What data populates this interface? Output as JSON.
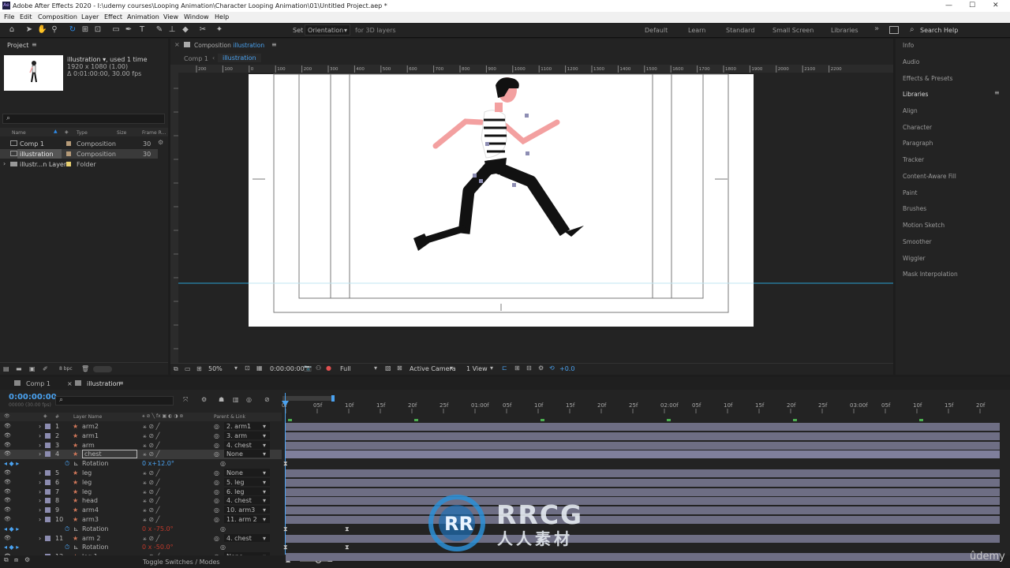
{
  "window": {
    "title": "Adobe After Effects 2020 - I:\\udemy courses\\Looping Animation\\Character Looping Animation\\01\\Untitled Project.aep *",
    "app_icon": "Ae",
    "minimize": "—",
    "maximize": "☐",
    "close": "✕"
  },
  "menu": [
    "File",
    "Edit",
    "Composition",
    "Layer",
    "Effect",
    "Animation",
    "View",
    "Window",
    "Help"
  ],
  "toolbar": {
    "set_label": "Set",
    "orientation": "Orientation",
    "for3d": "for 3D layers",
    "workspaces": [
      "Default",
      "Learn",
      "Standard",
      "Small Screen",
      "Libraries"
    ],
    "more": "»",
    "search_placeholder": "Search Help"
  },
  "project": {
    "title": "Project",
    "menu_icon": "≡",
    "item_name": "illustration ▾",
    "used": ", used 1 time",
    "size": "1920 x 1080 (1.00)",
    "duration": "Δ 0:01:00:00, 30.00 fps",
    "search_icon": "⌕",
    "headers": [
      "Name",
      "Type",
      "Size",
      "Frame R..."
    ],
    "items": [
      {
        "name": "Comp 1",
        "type": "Composition",
        "fps": "30"
      },
      {
        "name": "illustration",
        "type": "Composition",
        "fps": "30"
      },
      {
        "name": "illustr...n Layers",
        "type": "Folder",
        "fps": ""
      }
    ],
    "bpc": "8 bpc"
  },
  "composition": {
    "panel_title": "Composition",
    "panel_comp": "illustration",
    "menu_icon": "≡",
    "breadcrumb": [
      "Comp 1",
      "illustration"
    ],
    "zoom": "50%",
    "time": "0:00:00:00",
    "resolution": "Full",
    "camera": "Active Camera",
    "view": "1 View",
    "exposure": "+0.0",
    "ruler": [
      "200",
      "100",
      "0",
      "100",
      "200",
      "300",
      "400",
      "500",
      "600",
      "700",
      "800",
      "900",
      "1000",
      "1100",
      "1200",
      "1300",
      "1400",
      "1500",
      "1600",
      "1700",
      "1800",
      "1900",
      "2000",
      "2100",
      "2200"
    ]
  },
  "right_panels": [
    "Info",
    "Audio",
    "Effects & Presets",
    "Libraries",
    "Align",
    "Character",
    "Paragraph",
    "Tracker",
    "Content-Aware Fill",
    "Paint",
    "Brushes",
    "Motion Sketch",
    "Smoother",
    "Wiggler",
    "Mask Interpolation"
  ],
  "right_menu": "≡",
  "timeline": {
    "tabs": [
      {
        "name": "Comp 1"
      },
      {
        "name": "illustration"
      }
    ],
    "close": "×",
    "menu_icon": "≡",
    "timecode": "0:00:00:00",
    "fps_sub": "00000 (30.00 fps)",
    "col_headers": {
      "num": "#",
      "layer_name": "Layer Name",
      "parent": "Parent & Link"
    },
    "ruler": [
      "0f",
      "05f",
      "10f",
      "15f",
      "20f",
      "25f",
      "01:00f",
      "05f",
      "10f",
      "15f",
      "20f",
      "25f",
      "02:00f",
      "05f",
      "10f",
      "15f",
      "20f",
      "25f",
      "03:00f",
      "05f",
      "10f",
      "15f",
      "20f"
    ],
    "layers": [
      {
        "num": "1",
        "name": "arm2",
        "parent": "2. arm1"
      },
      {
        "num": "2",
        "name": "arm1",
        "parent": "3. arm"
      },
      {
        "num": "3",
        "name": "arm",
        "parent": "4. chest"
      },
      {
        "num": "4",
        "name": "chest",
        "parent": "None"
      },
      {
        "num": "",
        "name": "Rotation",
        "value": "0 x+12.0°"
      },
      {
        "num": "5",
        "name": "leg",
        "parent": "None"
      },
      {
        "num": "6",
        "name": "leg",
        "parent": "5. leg"
      },
      {
        "num": "7",
        "name": "leg",
        "parent": "6. leg"
      },
      {
        "num": "8",
        "name": "head",
        "parent": "4. chest"
      },
      {
        "num": "9",
        "name": "arm4",
        "parent": "10. arm3"
      },
      {
        "num": "10",
        "name": "arm3",
        "parent": "11. arm 2"
      },
      {
        "num": "",
        "name": "Rotation",
        "value": "0 x -75.0°"
      },
      {
        "num": "11",
        "name": "arm 2",
        "parent": "4. chest"
      },
      {
        "num": "",
        "name": "Rotation",
        "value": "0 x -50.0°"
      },
      {
        "num": "12",
        "name": "leg 1",
        "parent": "None"
      }
    ],
    "toggle": "Toggle Switches / Modes"
  },
  "watermark": {
    "logo": "RRCG",
    "sub": "人人素材",
    "udemy": "ûdemy"
  },
  "colors": {
    "accent": "#2d8ceb",
    "layer_bar": "#6e6e84",
    "keyframe": "#4caf50",
    "panel": "#232323"
  }
}
